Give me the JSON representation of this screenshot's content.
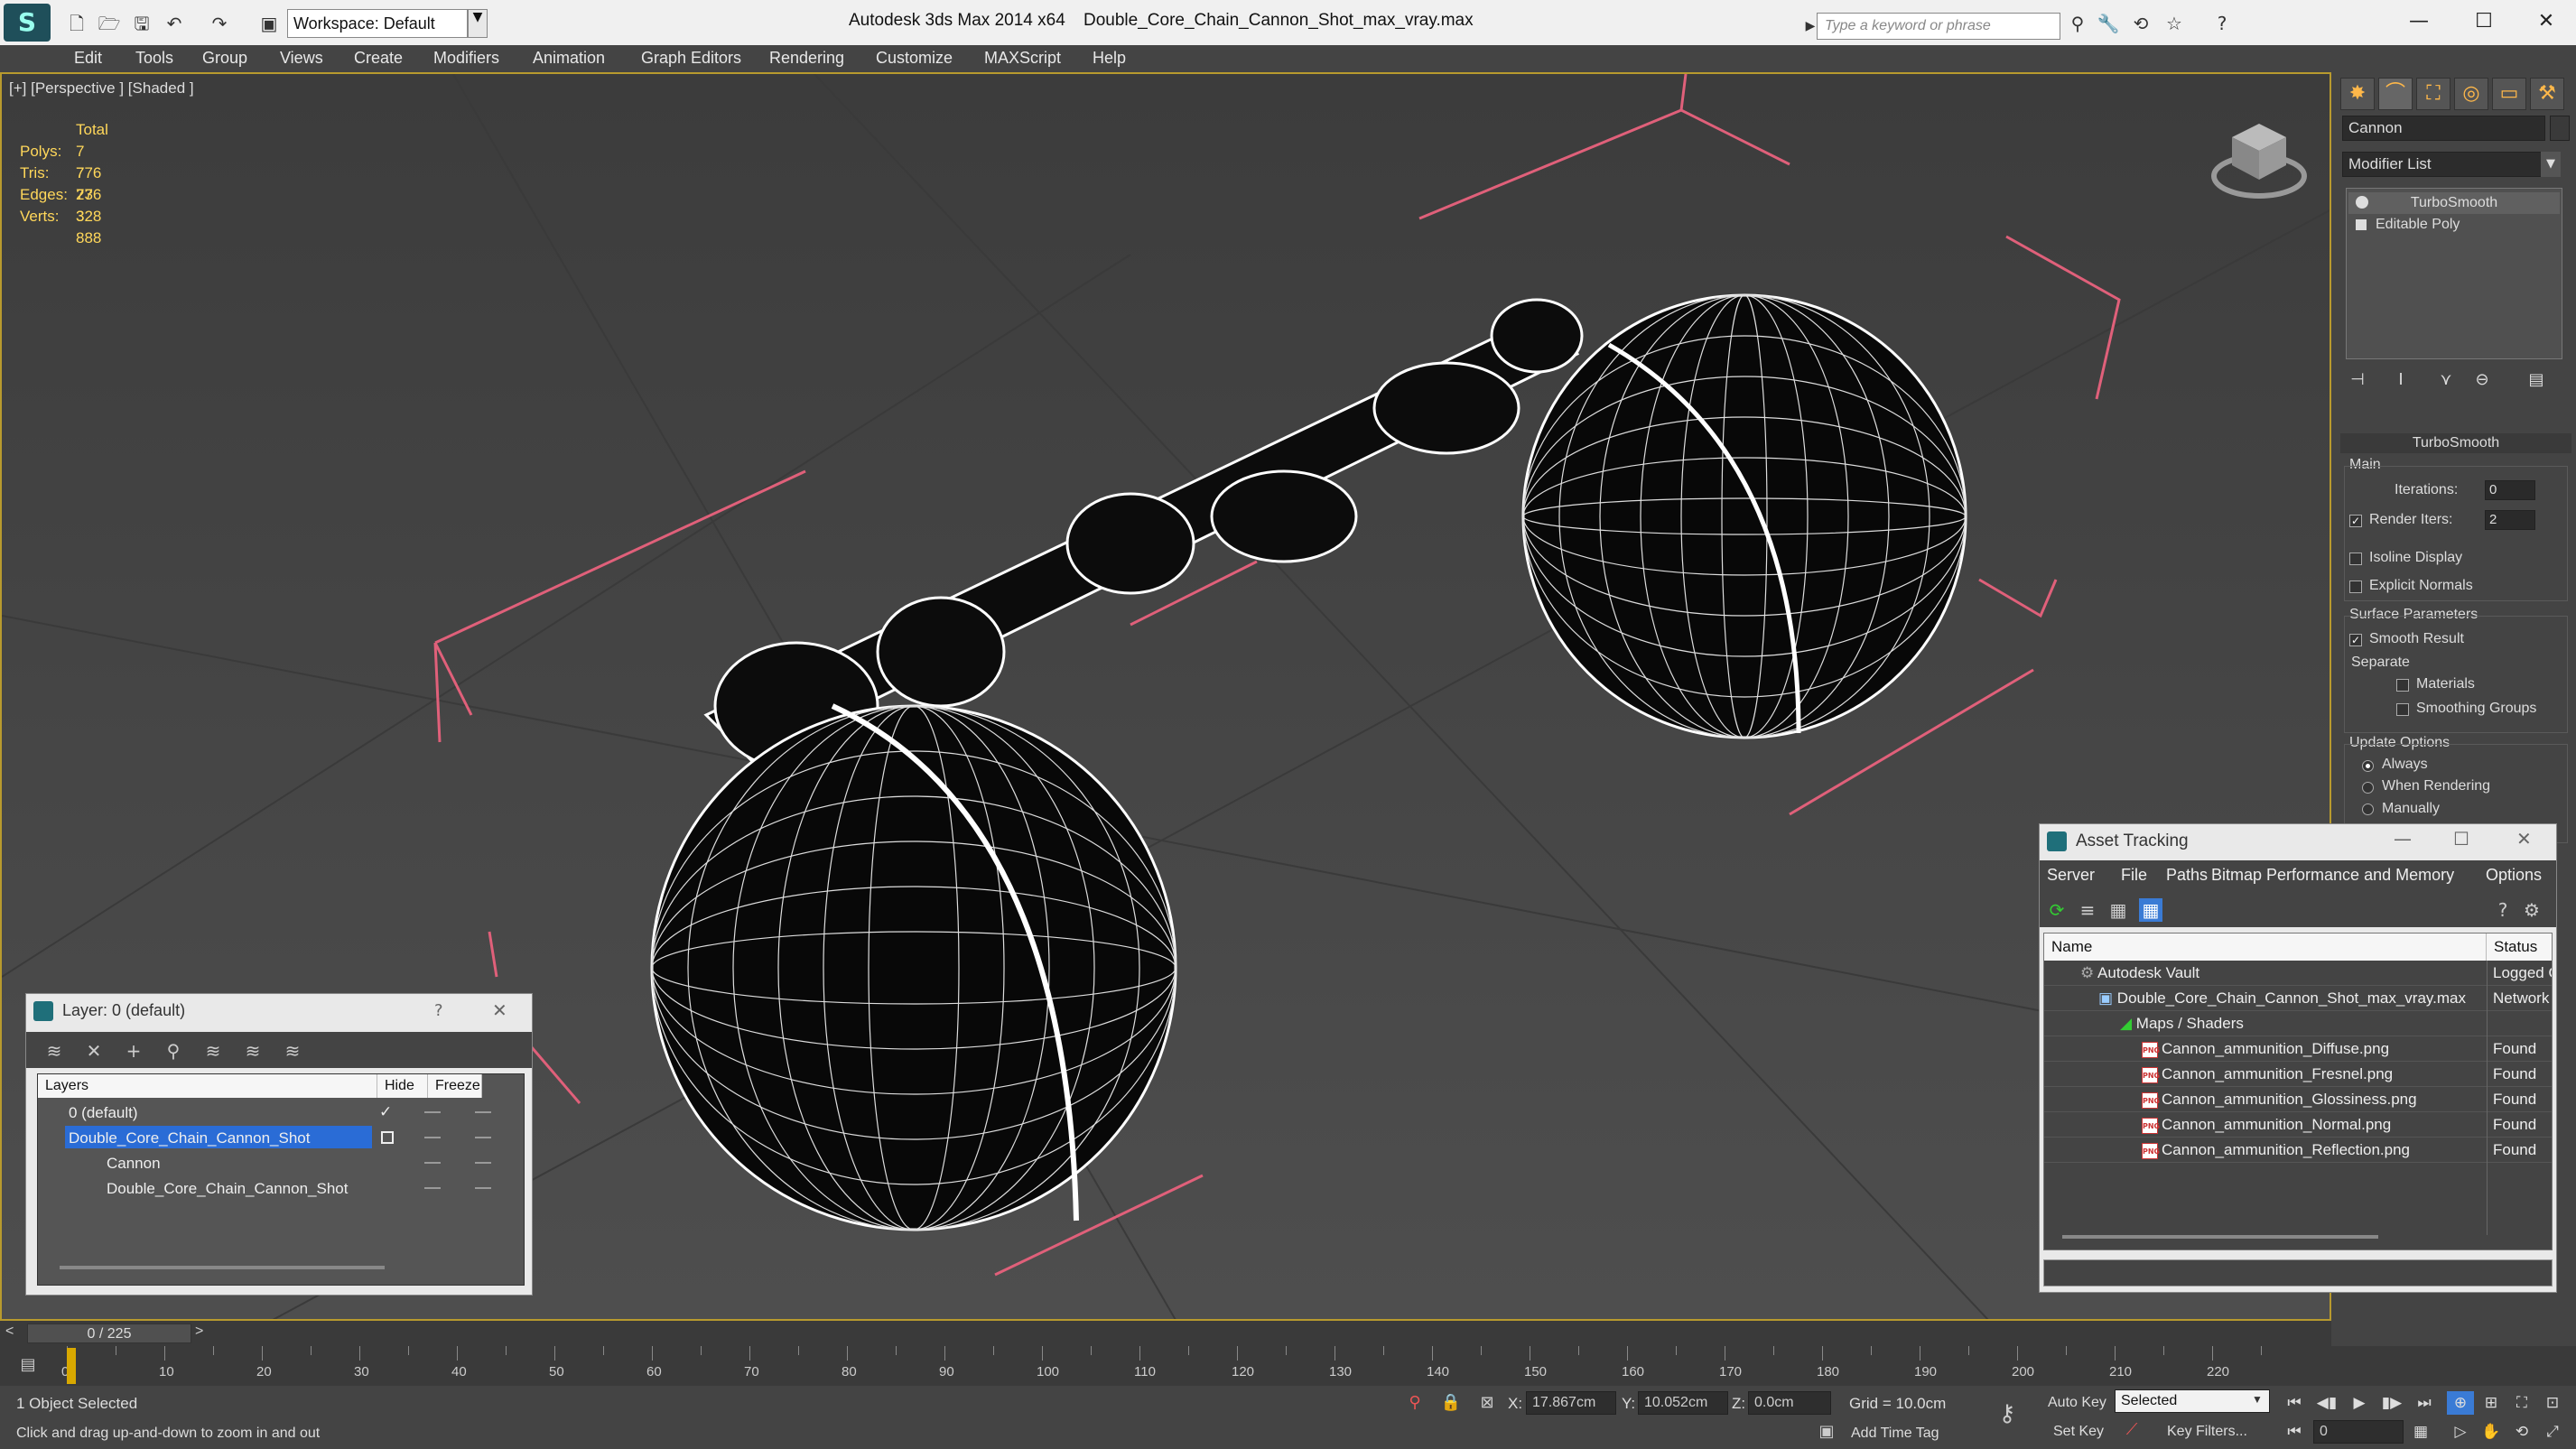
{
  "titlebar": {
    "workspace": "Workspace: Default",
    "app_title": "Autodesk 3ds Max  2014 x64",
    "file_title": "Double_Core_Chain_Cannon_Shot_max_vray.max",
    "search_placeholder": "Type a keyword or phrase"
  },
  "menu": [
    "Edit",
    "Tools",
    "Group",
    "Views",
    "Create",
    "Modifiers",
    "Animation",
    "Graph Editors",
    "Rendering",
    "Customize",
    "MAXScript",
    "Help"
  ],
  "viewport": {
    "label": "[+] [Perspective ] [Shaded ]",
    "stats": {
      "header": "Total",
      "rows": [
        {
          "k": "Polys:",
          "v": "7 776"
        },
        {
          "k": "Tris:",
          "v": "7 776"
        },
        {
          "k": "Edges:",
          "v": "23 328"
        },
        {
          "k": "Verts:",
          "v": "3 888"
        }
      ]
    }
  },
  "command_panel": {
    "object_name": "Cannon",
    "modifier_list": "Modifier List",
    "stack": [
      "TurboSmooth",
      "Editable Poly"
    ],
    "turbosmooth": {
      "title": "TurboSmooth",
      "main": "Main",
      "iterations_label": "Iterations:",
      "iterations": "0",
      "render_iters_label": "Render Iters:",
      "render_iters": "2",
      "isoline": "Isoline Display",
      "explicit_normals": "Explicit Normals",
      "surface_params": "Surface Parameters",
      "smooth_result": "Smooth Result",
      "separate": "Separate",
      "materials": "Materials",
      "smoothing_groups": "Smoothing Groups",
      "update_options": "Update Options",
      "always": "Always",
      "when_rendering": "When Rendering",
      "manually": "Manually"
    }
  },
  "layer_dialog": {
    "title": "Layer: 0 (default)",
    "help": "?",
    "columns": [
      "Layers",
      "Hide",
      "Freeze"
    ],
    "rows": [
      "0 (default)",
      "Double_Core_Chain_Cannon_Shot",
      "Cannon",
      "Double_Core_Chain_Cannon_Shot"
    ]
  },
  "asset_dialog": {
    "title": "Asset Tracking",
    "menu": [
      "Server",
      "File",
      "Paths",
      "Bitmap Performance and Memory",
      "Options"
    ],
    "columns": [
      "Name",
      "Status"
    ],
    "rows": [
      {
        "name": "Autodesk Vault",
        "status": "Logged O"
      },
      {
        "name": "Double_Core_Chain_Cannon_Shot_max_vray.max",
        "status": "Network"
      },
      {
        "name": "Maps / Shaders",
        "status": ""
      },
      {
        "name": "Cannon_ammunition_Diffuse.png",
        "status": "Found"
      },
      {
        "name": "Cannon_ammunition_Fresnel.png",
        "status": "Found"
      },
      {
        "name": "Cannon_ammunition_Glossiness.png",
        "status": "Found"
      },
      {
        "name": "Cannon_ammunition_Normal.png",
        "status": "Found"
      },
      {
        "name": "Cannon_ammunition_Reflection.png",
        "status": "Found"
      }
    ]
  },
  "timeline": {
    "frame": "0 / 225",
    "ticks": [
      "0",
      "10",
      "20",
      "30",
      "40",
      "50",
      "60",
      "70",
      "80",
      "90",
      "100",
      "110",
      "120",
      "130",
      "140",
      "150",
      "160",
      "170",
      "180",
      "190",
      "200",
      "210",
      "220"
    ]
  },
  "status": {
    "selected": "1 Object Selected",
    "hint": "Click and drag up-and-down to zoom in and out",
    "x_label": "X:",
    "x": "17.867cm",
    "y_label": "Y:",
    "y": "10.052cm",
    "z_label": "Z:",
    "z": "0.0cm",
    "grid": "Grid = 10.0cm",
    "add_time_tag": "Add Time Tag",
    "auto_key": "Auto Key",
    "set_key": "Set Key",
    "selected_dropdown": "Selected",
    "key_filters": "Key Filters...",
    "frame_field": "0"
  },
  "colors": {
    "accent": "#b89a2e",
    "selection": "#2a6cd6",
    "stats": "#ffd75a",
    "gizmo_lines": "#e0607a"
  }
}
